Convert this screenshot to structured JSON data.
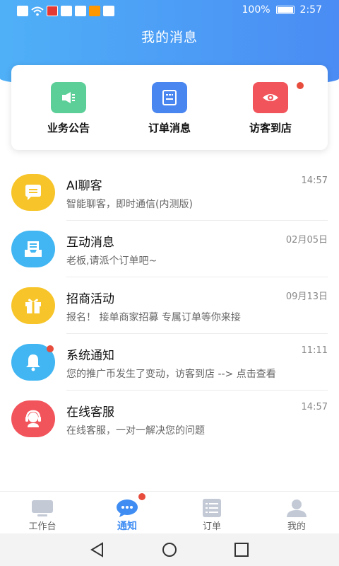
{
  "status_bar": {
    "battery": "100%",
    "time": "2:57"
  },
  "header": {
    "title": "我的消息"
  },
  "shortcuts": [
    {
      "label": "业务公告",
      "color": "#5ccf98",
      "icon": "megaphone-icon"
    },
    {
      "label": "订单消息",
      "color": "#4a86f0",
      "icon": "receipt-icon"
    },
    {
      "label": "访客到店",
      "color": "#f2545b",
      "icon": "eye-icon",
      "badge": true
    }
  ],
  "messages": [
    {
      "title": "AI聊客",
      "time": "14:57",
      "subtitle": "智能聊客，即时通信(内测版)",
      "color": "#f7c52a",
      "icon": "chat-bubble-icon"
    },
    {
      "title": "互动消息",
      "time": "02月05日",
      "subtitle": "老板,请派个订单吧~",
      "color": "#41b6f2",
      "icon": "inbox-icon"
    },
    {
      "title": "招商活动",
      "time": "09月13日",
      "subtitle": "报名！ 接单商家招募 专属订单等你来接",
      "color": "#f7c52a",
      "icon": "gift-icon"
    },
    {
      "title": "系统通知",
      "time": "11:11",
      "subtitle": "您的推广币发生了变动，访客到店 --> 点击查看",
      "color": "#41b6f2",
      "icon": "bell-icon",
      "badge": true
    },
    {
      "title": "在线客服",
      "time": "14:57",
      "subtitle": "在线客服，一对一解决您的问题",
      "color": "#f2545b",
      "icon": "headset-icon"
    }
  ],
  "tabbar": [
    {
      "label": "工作台",
      "icon": "monitor-icon",
      "active": false
    },
    {
      "label": "通知",
      "icon": "message-dots-icon",
      "active": true,
      "badge": true
    },
    {
      "label": "订单",
      "icon": "list-icon",
      "active": false
    },
    {
      "label": "我的",
      "icon": "user-icon",
      "active": false
    }
  ],
  "colors": {
    "accent": "#3f8df3",
    "badge": "#e74c3c",
    "tab_inactive": "#c3cad6"
  }
}
